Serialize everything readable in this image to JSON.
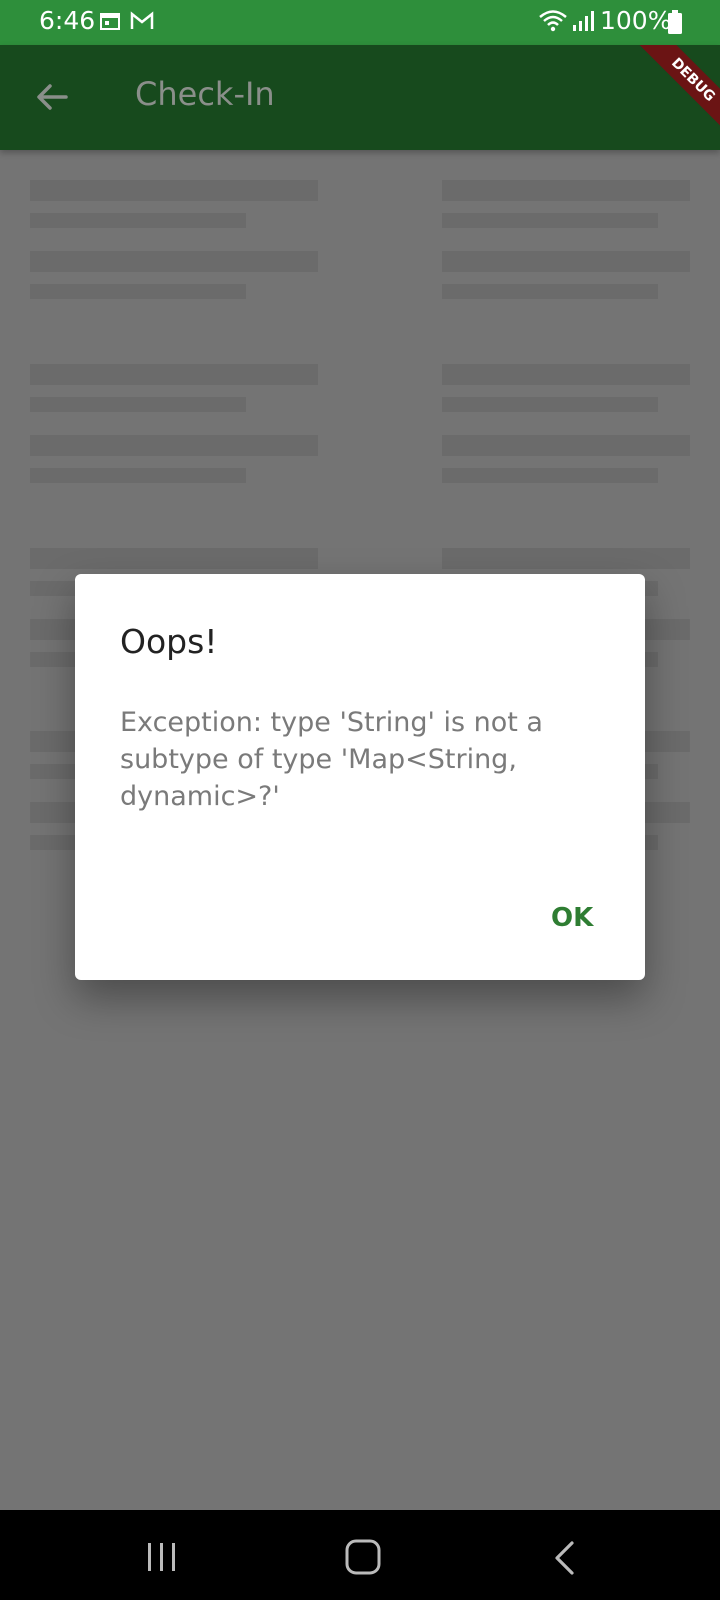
{
  "status_bar": {
    "time": "6:46",
    "battery": "100%",
    "icons": [
      "calendar-icon",
      "gmail-icon",
      "wifi-icon",
      "signal-icon",
      "battery-icon"
    ]
  },
  "app_bar": {
    "title": "Check-In",
    "back_icon": "arrow-back-icon",
    "debug_banner": "DEBUG"
  },
  "dialog": {
    "title": "Oops!",
    "message": "Exception: type 'String' is not a subtype of type 'Map<String, dynamic>?'",
    "ok_label": "OK"
  },
  "colors": {
    "status_bar": "#2e8f3b",
    "app_bar": "#174a1d",
    "accent": "#2e7d32",
    "scrim": "#747474"
  },
  "nav_bar": {
    "icons": [
      "recent-apps-icon",
      "home-icon",
      "back-icon"
    ]
  }
}
